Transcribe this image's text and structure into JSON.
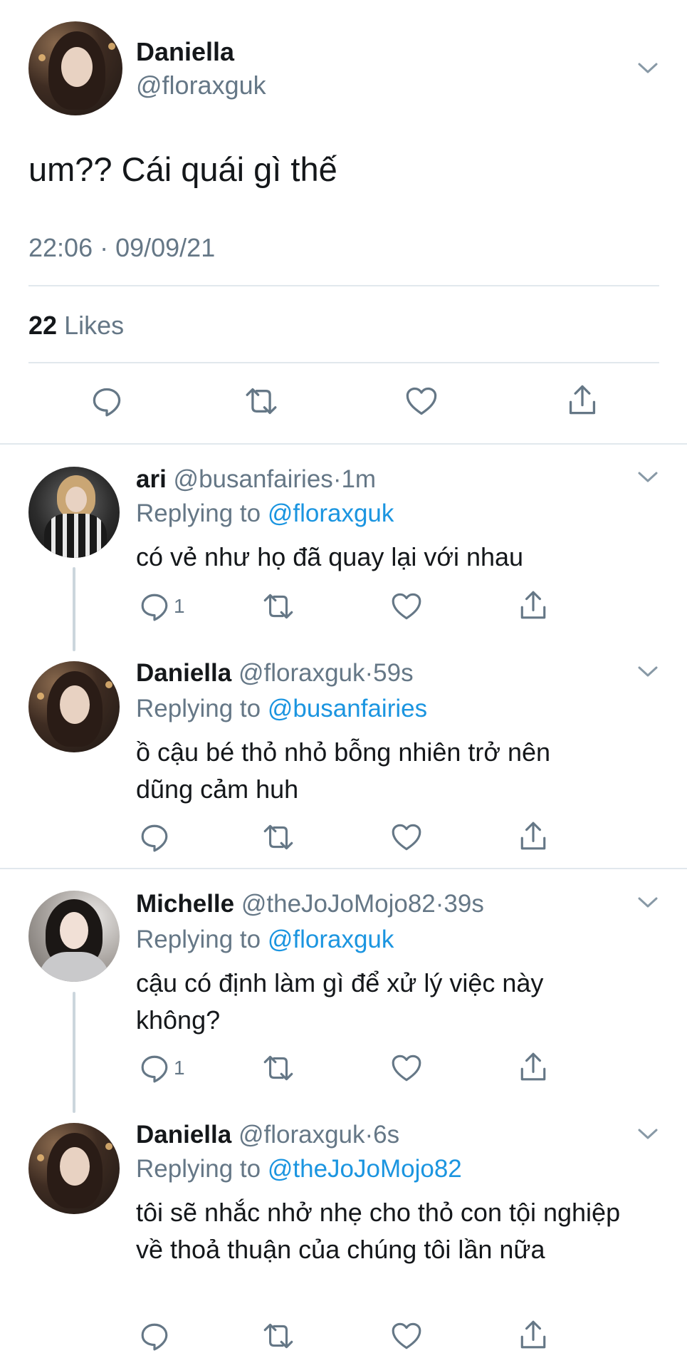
{
  "main_tweet": {
    "name": "Daniella",
    "handle": "@floraxguk",
    "text": "um?? Cái quái gì thế",
    "timestamp": "22:06 · 09/09/21",
    "likes_count": "22",
    "likes_label": "Likes"
  },
  "replies": [
    {
      "name": "ari",
      "handle": "@busanfairies",
      "sep": "·",
      "time": "1m",
      "replying_label": "Replying to",
      "replying_to": "@floraxguk",
      "text": "có vẻ như họ đã quay lại với nhau",
      "reply_count": "1"
    },
    {
      "name": "Daniella",
      "handle": "@floraxguk",
      "sep": "·",
      "time": "59s",
      "replying_label": "Replying to",
      "replying_to": "@busanfairies",
      "text": "ồ cậu bé thỏ nhỏ bỗng nhiên trở nên dũng cảm huh",
      "reply_count": ""
    },
    {
      "name": "Michelle",
      "handle": "@theJoJoMojo82",
      "sep": "·",
      "time": "39s",
      "replying_label": "Replying to",
      "replying_to": "@floraxguk",
      "text": "cậu có định làm gì để xử lý việc này không?",
      "reply_count": "1"
    },
    {
      "name": "Daniella",
      "handle": "@floraxguk",
      "sep": "·",
      "time": "6s",
      "replying_label": "Replying to",
      "replying_to": "@theJoJoMojo82",
      "text": "tôi sẽ nhắc nhở nhẹ cho thỏ con tội nghiệp về thoả thuận của chúng tôi lần nữa",
      "reply_count": ""
    }
  ],
  "icons": [
    "reply-icon",
    "retweet-icon",
    "like-icon",
    "share-icon",
    "chevron-down-icon"
  ],
  "colors": {
    "link": "#1b95e0",
    "secondary": "#657786",
    "divider": "#e1e8ed"
  }
}
